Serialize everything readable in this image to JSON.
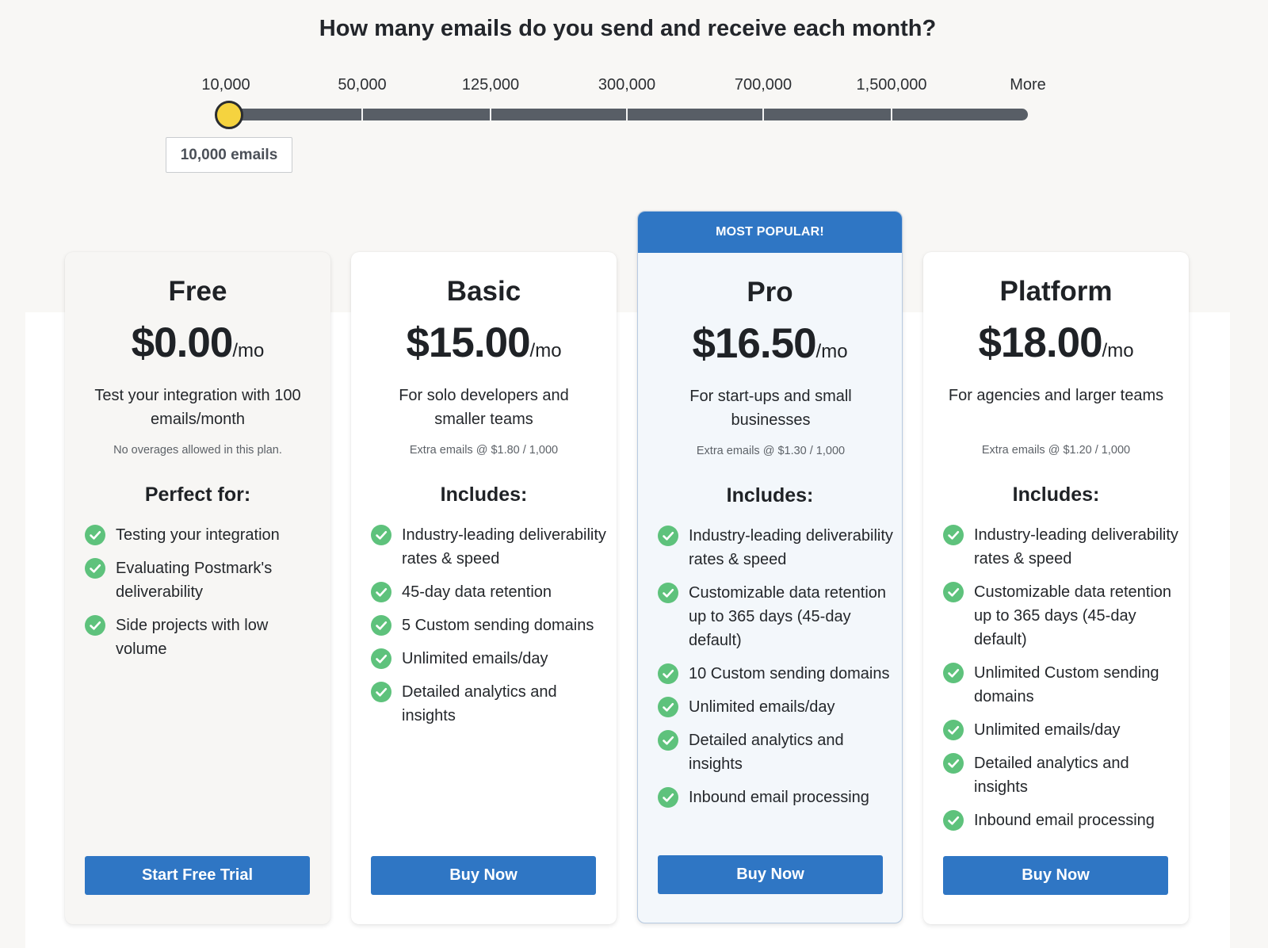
{
  "question": "How many emails do you send and receive each month?",
  "slider": {
    "ticks": [
      "10,000",
      "50,000",
      "125,000",
      "300,000",
      "700,000",
      "1,500,000",
      "More"
    ],
    "selected_index": 0,
    "value_label": "10,000 emails"
  },
  "plans": [
    {
      "name": "Free",
      "price": "$0.00",
      "period": "/mo",
      "description": "Test your integration with 100 emails/month",
      "note": "No overages allowed in this plan.",
      "section_title": "Perfect for:",
      "features": [
        "Testing your integration",
        "Evaluating Postmark's deliverability",
        "Side projects with low volume"
      ],
      "cta": "Start Free Trial"
    },
    {
      "name": "Basic",
      "price": "$15.00",
      "period": "/mo",
      "description": "For solo developers and smaller teams",
      "note": "Extra emails @ $1.80 / 1,000",
      "section_title": "Includes:",
      "features": [
        "Industry-leading deliverability rates & speed",
        "45-day data retention",
        "5 Custom sending domains",
        "Unlimited emails/day",
        "Detailed analytics and insights"
      ],
      "cta": "Buy Now"
    },
    {
      "badge": "MOST POPULAR!",
      "name": "Pro",
      "price": "$16.50",
      "period": "/mo",
      "description": "For start-ups and small businesses",
      "note": "Extra emails @ $1.30 / 1,000",
      "section_title": "Includes:",
      "features": [
        "Industry-leading deliverability rates & speed",
        "Customizable data retention up to 365 days (45-day default)",
        "10 Custom sending domains",
        "Unlimited emails/day",
        "Detailed analytics and insights",
        "Inbound email processing"
      ],
      "cta": "Buy Now"
    },
    {
      "name": "Platform",
      "price": "$18.00",
      "period": "/mo",
      "description": "For agencies and larger teams",
      "note": "Extra emails @ $1.20 / 1,000",
      "section_title": "Includes:",
      "features": [
        "Industry-leading deliverability rates & speed",
        "Customizable data retention up to 365 days (45-day default)",
        "Unlimited Custom sending domains",
        "Unlimited emails/day",
        "Detailed analytics and insights",
        "Inbound email processing"
      ],
      "cta": "Buy Now"
    }
  ],
  "colors": {
    "accent": "#2f76c4",
    "check": "#5ec27c",
    "slider_thumb": "#f5d33f",
    "slider_track": "#585e66"
  }
}
